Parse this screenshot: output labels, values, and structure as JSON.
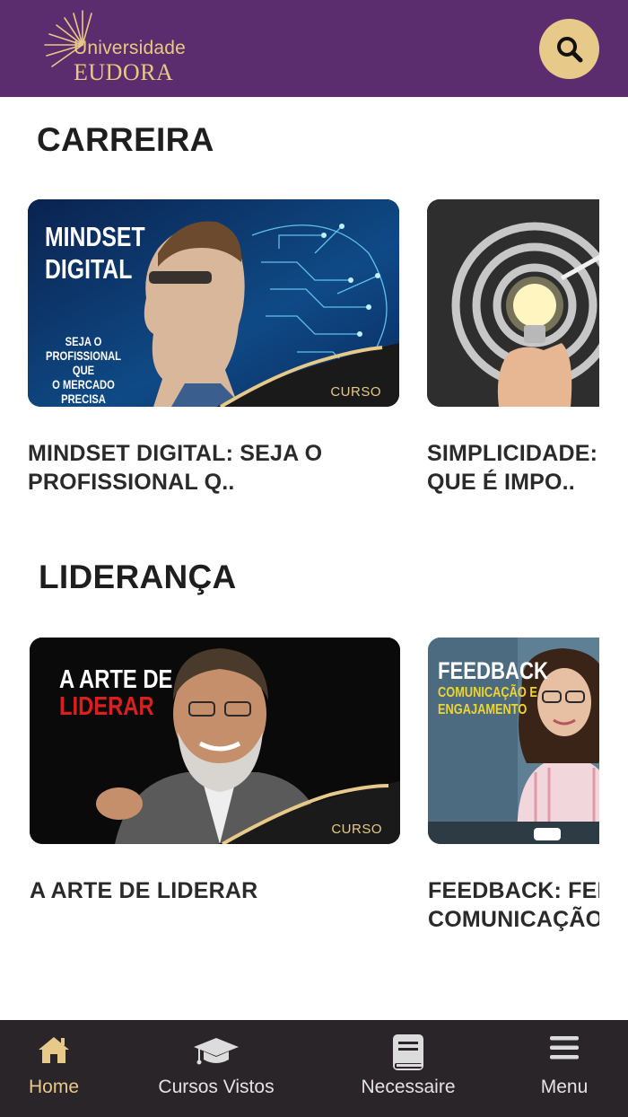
{
  "header": {
    "logo_line1": "Universidade",
    "logo_line2": "EUDORA",
    "colors": {
      "bar": "#5b2d6e",
      "accent": "#e7c98a"
    }
  },
  "sections": [
    {
      "title": "CARREIRA",
      "cards": [
        {
          "thumb_heading_1": "MINDSET",
          "thumb_heading_2": "DIGITAL",
          "thumb_sub_1": "SEJA O",
          "thumb_sub_2": "PROFISSIONAL QUE",
          "thumb_sub_3": "O MERCADO",
          "thumb_sub_4": "PRECISA",
          "badge": "CURSO",
          "title_line1": "MINDSET DIGITAL: SEJA O",
          "title_line2": "PROFISSIONAL Q.."
        },
        {
          "title_line1": "SIMPLICIDADE:",
          "title_line2": "QUE É IMPO.."
        }
      ]
    },
    {
      "title": "LIDERANÇA",
      "cards": [
        {
          "thumb_heading_1": "A ARTE DE",
          "thumb_heading_2": "LIDERAR",
          "badge": "CURSO",
          "title_line1": "A ARTE DE LIDERAR"
        },
        {
          "thumb_heading_1": "FEEDBACK",
          "thumb_sub_1": "COMUNICAÇÃO E",
          "thumb_sub_2": "ENGAJAMENTO",
          "title_line1": "FEEDBACK: FER",
          "title_line2": "COMUNICAÇÃO"
        }
      ]
    }
  ],
  "bottom_nav": {
    "items": [
      {
        "label": "Home",
        "icon": "home-icon",
        "active": true
      },
      {
        "label": "Cursos Vistos",
        "icon": "graduation-cap-icon",
        "active": false
      },
      {
        "label": "Necessaire",
        "icon": "book-icon",
        "active": false
      },
      {
        "label": "Menu",
        "icon": "hamburger-menu-icon",
        "active": false
      }
    ]
  }
}
